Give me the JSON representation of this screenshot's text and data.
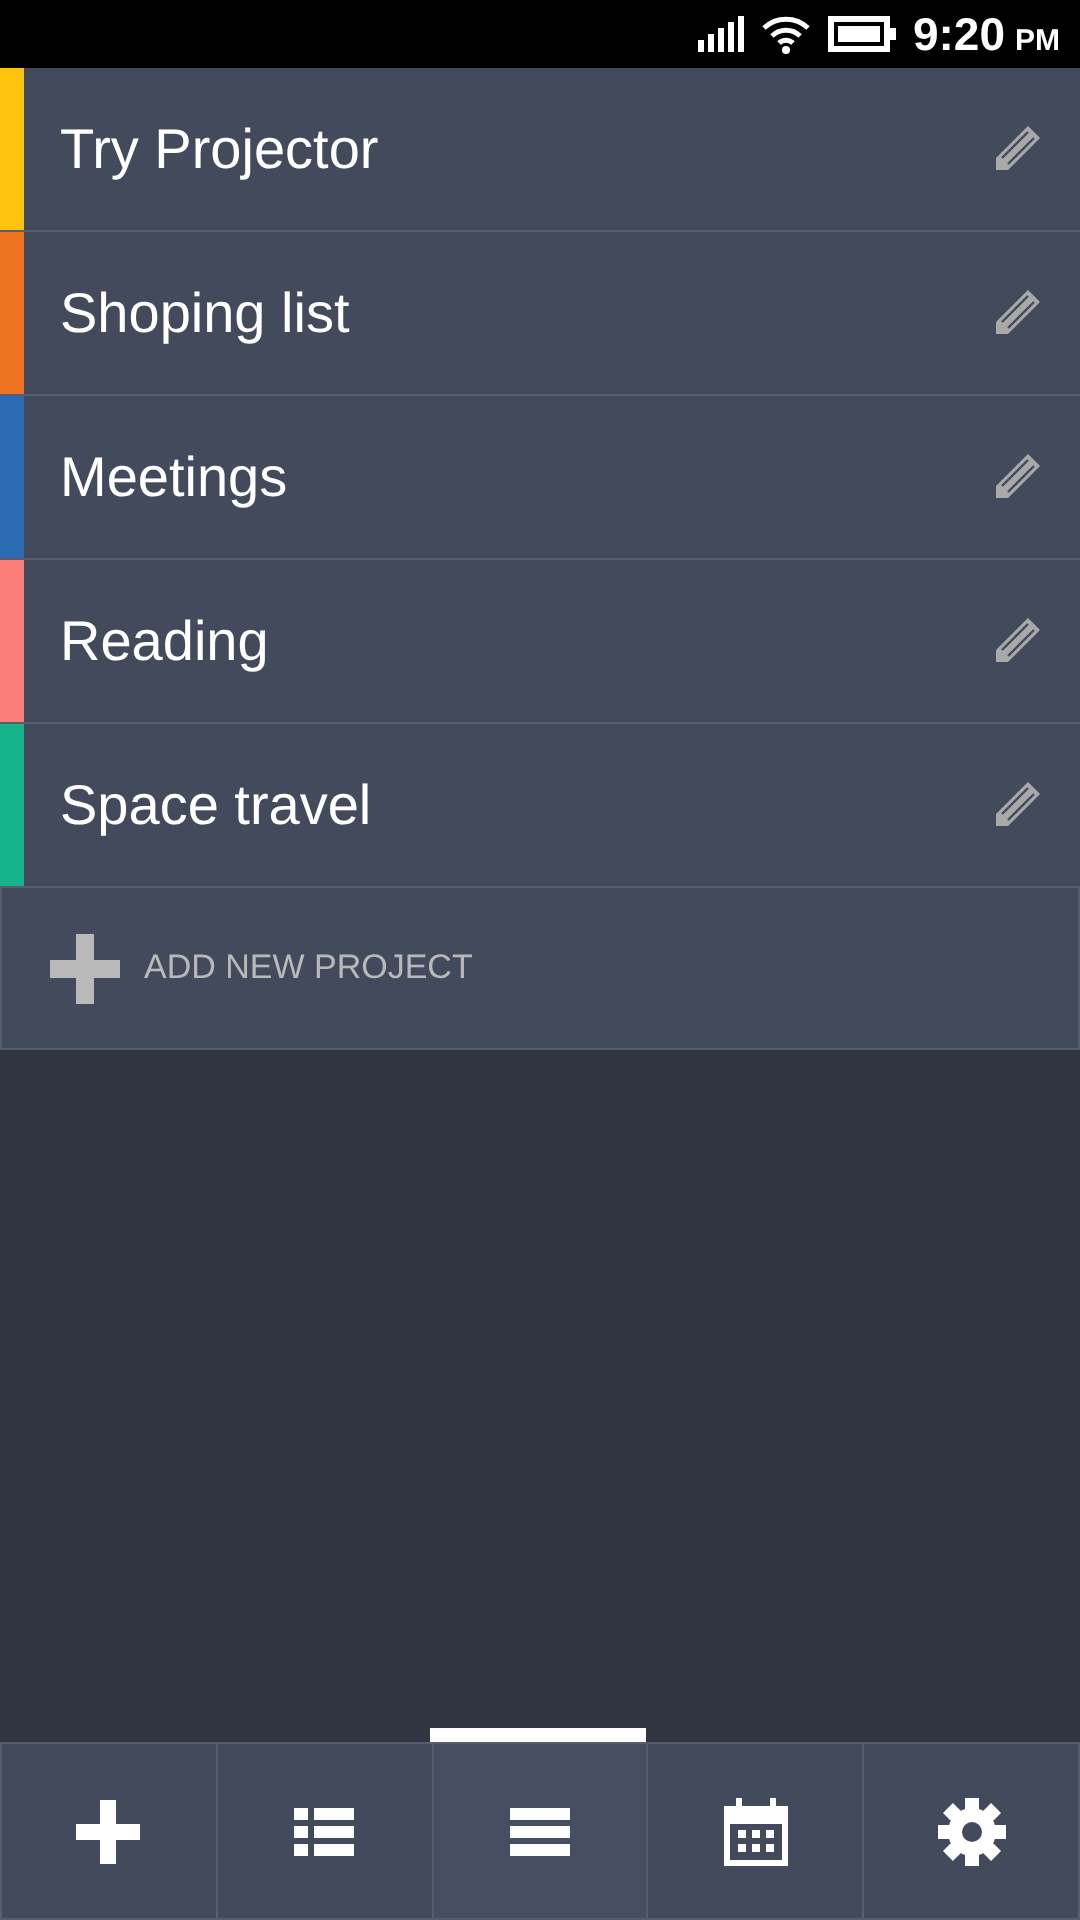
{
  "status_bar": {
    "time": "9:20",
    "period": "PM"
  },
  "projects": [
    {
      "name": "Try Projector",
      "color": "#fec30c"
    },
    {
      "name": "Shoping list",
      "color": "#f07323"
    },
    {
      "name": "Meetings",
      "color": "#2b6cb4"
    },
    {
      "name": "Reading",
      "color": "#fb7e78"
    },
    {
      "name": "Space travel",
      "color": "#15b48c"
    }
  ],
  "add_project": {
    "label": "ADD NEW PROJECT"
  },
  "tabs": [
    {
      "kind": "add",
      "selected": false
    },
    {
      "kind": "list",
      "selected": false
    },
    {
      "kind": "menu",
      "selected": true
    },
    {
      "kind": "calendar",
      "selected": false
    },
    {
      "kind": "settings",
      "selected": false
    }
  ]
}
